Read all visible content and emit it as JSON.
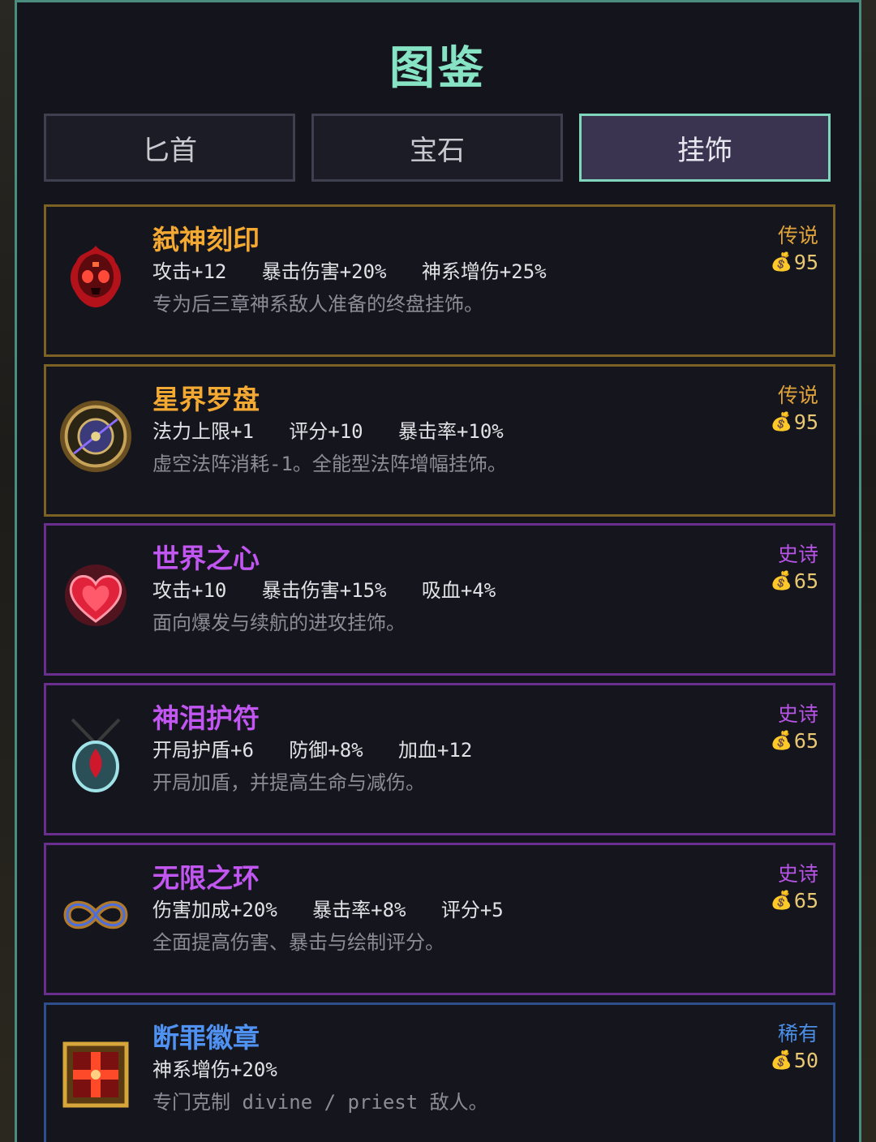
{
  "title": "图鉴",
  "tabs": [
    {
      "label": "匕首",
      "active": false
    },
    {
      "label": "宝石",
      "active": false
    },
    {
      "label": "挂饰",
      "active": true
    }
  ],
  "items": [
    {
      "name": "弑神刻印",
      "rarity": "传说",
      "price": "95",
      "stats": "攻击+12   暴击伤害+20%   神系增伤+25%",
      "desc": "专为后三章神系敌人准备的终盘挂饰。",
      "icon": "flaming-skull-icon"
    },
    {
      "name": "星界罗盘",
      "rarity": "传说",
      "price": "95",
      "stats": "法力上限+1   评分+10   暴击率+10%",
      "desc": "虚空法阵消耗-1。全能型法阵增幅挂饰。",
      "icon": "astral-compass-icon"
    },
    {
      "name": "世界之心",
      "rarity": "史诗",
      "price": "65",
      "stats": "攻击+10   暴击伤害+15%   吸血+4%",
      "desc": "面向爆发与续航的进攻挂饰。",
      "icon": "crystal-heart-icon"
    },
    {
      "name": "神泪护符",
      "rarity": "史诗",
      "price": "65",
      "stats": "开局护盾+6   防御+8%   加血+12",
      "desc": "开局加盾，并提高生命与减伤。",
      "icon": "tear-amulet-icon"
    },
    {
      "name": "无限之环",
      "rarity": "史诗",
      "price": "65",
      "stats": "伤害加成+20%   暴击率+8%   评分+5",
      "desc": "全面提高伤害、暴击与绘制评分。",
      "icon": "infinity-ring-icon"
    },
    {
      "name": "断罪徽章",
      "rarity": "稀有",
      "price": "50",
      "stats": "神系增伤+20%",
      "desc": "专门克制 divine / priest 敌人。",
      "icon": "cross-badge-icon"
    }
  ]
}
